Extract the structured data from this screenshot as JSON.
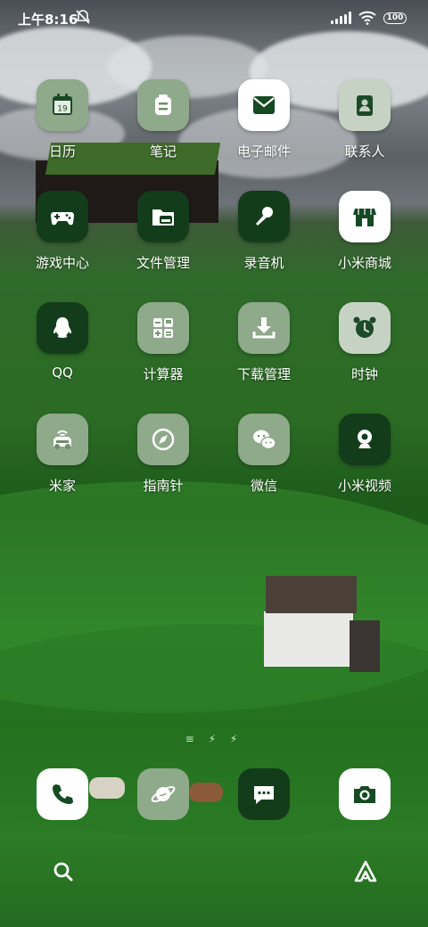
{
  "status_bar": {
    "time": "上午8:16",
    "battery": "100"
  },
  "apps": [
    {
      "label": "日历",
      "icon": "calendar-icon",
      "calendar_day": "19"
    },
    {
      "label": "笔记",
      "icon": "notes-icon"
    },
    {
      "label": "电子邮件",
      "icon": "mail-icon"
    },
    {
      "label": "联系人",
      "icon": "contacts-icon"
    },
    {
      "label": "游戏中心",
      "icon": "gamepad-icon"
    },
    {
      "label": "文件管理",
      "icon": "folder-icon"
    },
    {
      "label": "录音机",
      "icon": "microphone-icon"
    },
    {
      "label": "小米商城",
      "icon": "store-icon"
    },
    {
      "label": "QQ",
      "icon": "penguin-icon"
    },
    {
      "label": "计算器",
      "icon": "calculator-icon"
    },
    {
      "label": "下载管理",
      "icon": "download-icon"
    },
    {
      "label": "时钟",
      "icon": "alarm-clock-icon"
    },
    {
      "label": "米家",
      "icon": "smart-car-icon"
    },
    {
      "label": "指南针",
      "icon": "compass-icon"
    },
    {
      "label": "微信",
      "icon": "chat-bubbles-icon"
    },
    {
      "label": "小米视频",
      "icon": "webcam-icon"
    }
  ],
  "dock": [
    {
      "icon": "phone-icon"
    },
    {
      "icon": "browser-planet-icon"
    },
    {
      "icon": "message-icon"
    },
    {
      "icon": "camera-icon"
    }
  ],
  "bottom_bar": [
    {
      "icon": "search-icon"
    },
    {
      "icon": "assistant-icon"
    }
  ],
  "colors": {
    "icon_light": "#8fa98b",
    "icon_white": "#ffffff",
    "icon_dark": "#133c1b",
    "icon_pale": "#c6d3c4"
  }
}
